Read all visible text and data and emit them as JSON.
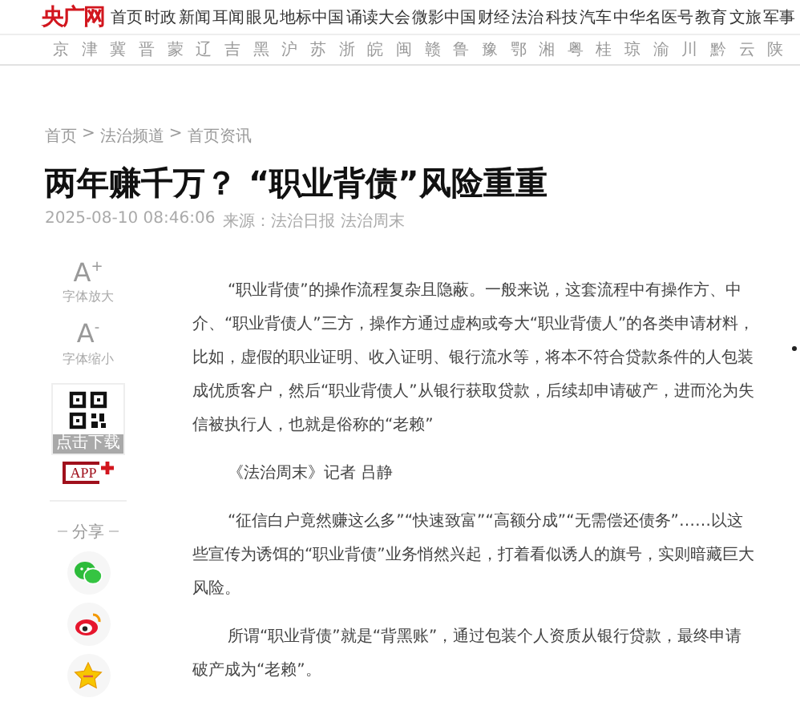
{
  "header": {
    "logo": "央广网",
    "nav": [
      "首页",
      "时政",
      "新闻",
      "耳闻",
      "眼见",
      "地标中国",
      "诵读大会",
      "微影中国",
      "财经",
      "法治",
      "科技",
      "汽车",
      "中华名医号",
      "教育",
      "文旅",
      "军事"
    ],
    "regions": [
      "京",
      "津",
      "冀",
      "晋",
      "蒙",
      "辽",
      "吉",
      "黑",
      "沪",
      "苏",
      "浙",
      "皖",
      "闽",
      "赣",
      "鲁",
      "豫",
      "鄂",
      "湘",
      "粤",
      "桂",
      "琼",
      "渝",
      "川",
      "黔",
      "云",
      "陕"
    ]
  },
  "breadcrumb": [
    "首页",
    ">",
    "法治频道",
    ">",
    "首页资讯"
  ],
  "article": {
    "title": "两年赚千万？ “职业背债”风险重重",
    "date": "2025-08-10 08:46:06",
    "source": "来源：法治日报 法治周末"
  },
  "sidebar": {
    "font_tools": [
      {
        "glyph": "A",
        "sign": "+",
        "label": "字体放大"
      },
      {
        "glyph": "A",
        "sign": "-",
        "label": "字体缩小"
      }
    ],
    "download": {
      "label": "点击下载",
      "app": "APP"
    },
    "share_label": "分享",
    "share": [
      {
        "kind": "wechat"
      },
      {
        "kind": "weibo"
      },
      {
        "kind": "star"
      }
    ]
  },
  "paragraphs": [
    "“职业背债”的操作流程复杂且隐蔽。一般来说，这套流程中有操作方、中介、“职业背债人”三方，操作方通过虚构或夸大“职业背债人”的各类申请材料，比如，虚假的职业证明、收入证明、银行流水等，将本不符合贷款条件的人包装成优质客户，然后“职业背债人”从银行获取贷款，后续却申请破产，进而沦为失信被执行人，也就是俗称的“老赖”",
    "《法治周末》记者 吕静",
    "“征信白户竟然赚这么多”“快速致富”“高额分成”“无需偿还债务”……以这些宣传为诱饵的“职业背债”业务悄然兴起，打着看似诱人的旗号，实则暗藏巨大风险。",
    "所谓“职业背债”就是“背黑账”，通过包装个人资质从银行贷款，最终申请破产成为“老赖”。"
  ]
}
